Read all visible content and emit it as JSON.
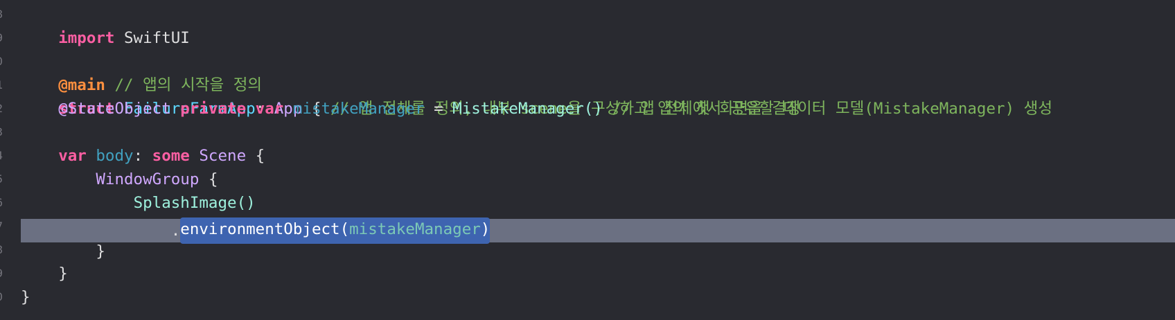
{
  "editor": {
    "gutter_numbers": [
      "8",
      "9",
      "0",
      "1",
      "2",
      "3",
      "4",
      "5",
      "6",
      "7",
      "8",
      "9",
      "0"
    ],
    "lines": {
      "l1": {
        "kw": "import",
        "module": "SwiftUI"
      },
      "l3": {
        "attr": "@main",
        "comment": "// 앱의 시작을 정의"
      },
      "l4": {
        "kw": "struct",
        "name": "FailureFarmApp",
        "colon": ":",
        "protocol": "App",
        "brace": "{",
        "comment": "// 앱 전체를 정의, 내부 scene을 구성하고 앱의 첫 화면을 결정"
      },
      "l5": {
        "attr": "@StateObject",
        "kw1": "private",
        "kw2": "var",
        "name": "mistakeManager",
        "eq": "=",
        "call": "MistakeManager()",
        "comment": "// 앱 전체에서 공유할 데이터 모델(MistakeManager) 생성"
      },
      "l7": {
        "kw1": "var",
        "name": "body",
        "colon": ":",
        "kw2": "some",
        "type": "Scene",
        "brace": "{"
      },
      "l8": {
        "type": "WindowGroup",
        "brace": "{"
      },
      "l9": {
        "call": "SplashImage()"
      },
      "l10": {
        "dot": ".",
        "method": "environmentObject(",
        "arg": "mistakeManager",
        "close": ")"
      },
      "l11": {
        "brace": "}"
      },
      "l12": {
        "brace": "}"
      },
      "l13": {
        "brace": "}"
      }
    },
    "colors": {
      "background": "#292a30",
      "current_line": "#6b7082",
      "selection": "#3e64b0",
      "keyword": "#fc5fa3",
      "comment": "#7eb55d",
      "attribute": "#fd8f3f",
      "declaration": "#5dd8ff"
    }
  }
}
